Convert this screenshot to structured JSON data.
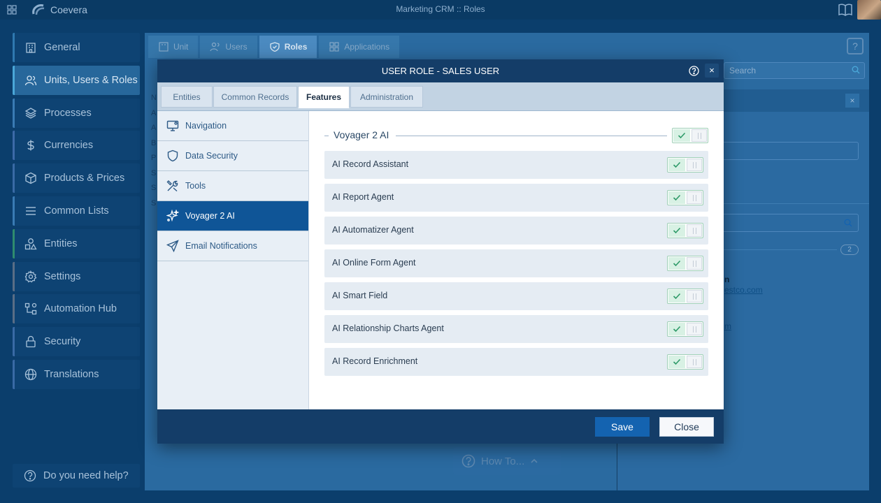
{
  "topbar": {
    "brand": "Coevera",
    "title": "Marketing CRM :: Roles"
  },
  "nav": {
    "items": [
      {
        "label": "General",
        "icon": "building-icon"
      },
      {
        "label": "Units, Users & Roles",
        "icon": "users-icon"
      },
      {
        "label": "Processes",
        "icon": "layers-icon"
      },
      {
        "label": "Currencies",
        "icon": "dollar-icon"
      },
      {
        "label": "Products & Prices",
        "icon": "box-icon"
      },
      {
        "label": "Common Lists",
        "icon": "list-icon"
      },
      {
        "label": "Entities",
        "icon": "shapes-icon"
      },
      {
        "label": "Settings",
        "icon": "gear-icon"
      },
      {
        "label": "Automation Hub",
        "icon": "flow-icon"
      },
      {
        "label": "Security",
        "icon": "lock-icon"
      },
      {
        "label": "Translations",
        "icon": "globe-icon"
      }
    ],
    "help": "Do you need help?"
  },
  "background": {
    "tabs": [
      "Unit",
      "Users",
      "Roles",
      "Applications"
    ],
    "search_placeholder": "Search",
    "count": "2",
    "name_fragment": "n",
    "email_fragment": "estco.com",
    "email_fragment2": "m",
    "list_letters": [
      "N",
      "A",
      "A",
      "B",
      "P",
      "S",
      "S",
      "S"
    ],
    "howto": "How To..."
  },
  "modal": {
    "title": "USER ROLE - SALES USER",
    "tabs": [
      "Entities",
      "Common Records",
      "Features",
      "Administration"
    ],
    "active_tab": "Features",
    "sidebar": [
      {
        "label": "Navigation",
        "icon": "monitor-icon"
      },
      {
        "label": "Data Security",
        "icon": "shield-icon"
      },
      {
        "label": "Tools",
        "icon": "tools-icon"
      },
      {
        "label": "Voyager 2 AI",
        "icon": "sparkle-icon"
      },
      {
        "label": "Email Notifications",
        "icon": "send-icon"
      }
    ],
    "active_section": "Voyager 2 AI",
    "section_title": "Voyager 2 AI",
    "section_enabled": true,
    "features": [
      {
        "label": "AI Record Assistant",
        "enabled": true
      },
      {
        "label": "AI Report Agent",
        "enabled": true
      },
      {
        "label": "AI Automatizer Agent",
        "enabled": true
      },
      {
        "label": "AI Online Form Agent",
        "enabled": true
      },
      {
        "label": "AI Smart Field",
        "enabled": true
      },
      {
        "label": "AI Relationship Charts Agent",
        "enabled": true
      },
      {
        "label": "AI Record Enrichment",
        "enabled": true
      }
    ],
    "save_label": "Save",
    "close_label": "Close"
  },
  "colors": {
    "header": "#143d68",
    "active_side": "#0f5597",
    "toggle_on": "#d8f1e4",
    "check": "#2e9a68"
  }
}
